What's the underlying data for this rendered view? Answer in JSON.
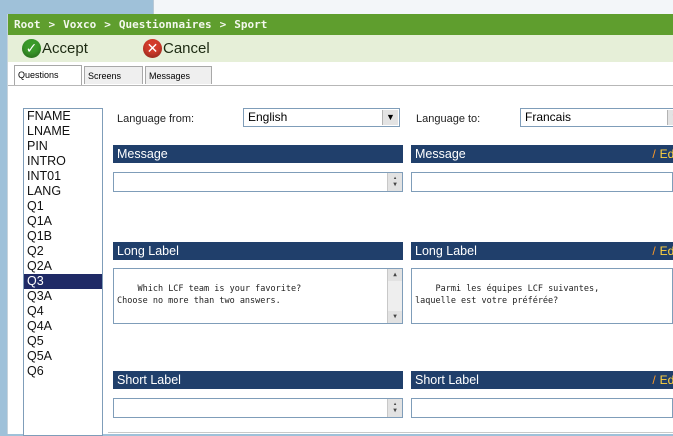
{
  "breadcrumb": [
    "Root",
    "Voxco",
    "Questionnaires",
    "Sport"
  ],
  "breadcrumb_separator": ">",
  "toolbar": {
    "accept_label": "Accept",
    "cancel_label": "Cancel"
  },
  "tabs": [
    {
      "label": "Questions",
      "active": true
    },
    {
      "label": "Screens",
      "active": false
    },
    {
      "label": "Messages",
      "active": false
    }
  ],
  "questions": [
    {
      "name": "FNAME",
      "selected": false
    },
    {
      "name": "LNAME",
      "selected": false
    },
    {
      "name": "PIN",
      "selected": false
    },
    {
      "name": "INTRO",
      "selected": false
    },
    {
      "name": "INT01",
      "selected": false
    },
    {
      "name": "LANG",
      "selected": false
    },
    {
      "name": "Q1",
      "selected": false
    },
    {
      "name": "Q1A",
      "selected": false
    },
    {
      "name": "Q1B",
      "selected": false
    },
    {
      "name": "Q2",
      "selected": false
    },
    {
      "name": "Q2A",
      "selected": false
    },
    {
      "name": "Q3",
      "selected": true
    },
    {
      "name": "Q3A",
      "selected": false
    },
    {
      "name": "Q4",
      "selected": false
    },
    {
      "name": "Q4A",
      "selected": false
    },
    {
      "name": "Q5",
      "selected": false
    },
    {
      "name": "Q5A",
      "selected": false
    },
    {
      "name": "Q6",
      "selected": false
    }
  ],
  "language": {
    "from_label": "Language from:",
    "from_value": "English",
    "to_label": "Language to:",
    "to_value": "Francais"
  },
  "sections": {
    "message": {
      "title": "Message",
      "source_text": "",
      "target_text": ""
    },
    "long_label": {
      "title": "Long Label",
      "source_text": "Which LCF team is your favorite?\nChoose no more than two answers.",
      "target_text": "Parmi les équipes LCF suivantes,\nlaquelle est votre préférée?"
    },
    "short_label": {
      "title": "Short Label",
      "source_text": "",
      "target_text": ""
    }
  },
  "edit_label": "Edi",
  "colors": {
    "breadcrumb_bg": "#5f9e2e",
    "toolbar_bg": "#e6efd8",
    "panel_header_bg": "#203f6b",
    "selected_item_bg": "#1f2a66",
    "accept_icon": "#3a9a2a",
    "cancel_icon": "#d23b2b",
    "edit_link": "#ffd23f"
  },
  "icons": {
    "accept": "check-icon",
    "cancel": "x-icon",
    "edit": "pencil-icon"
  }
}
